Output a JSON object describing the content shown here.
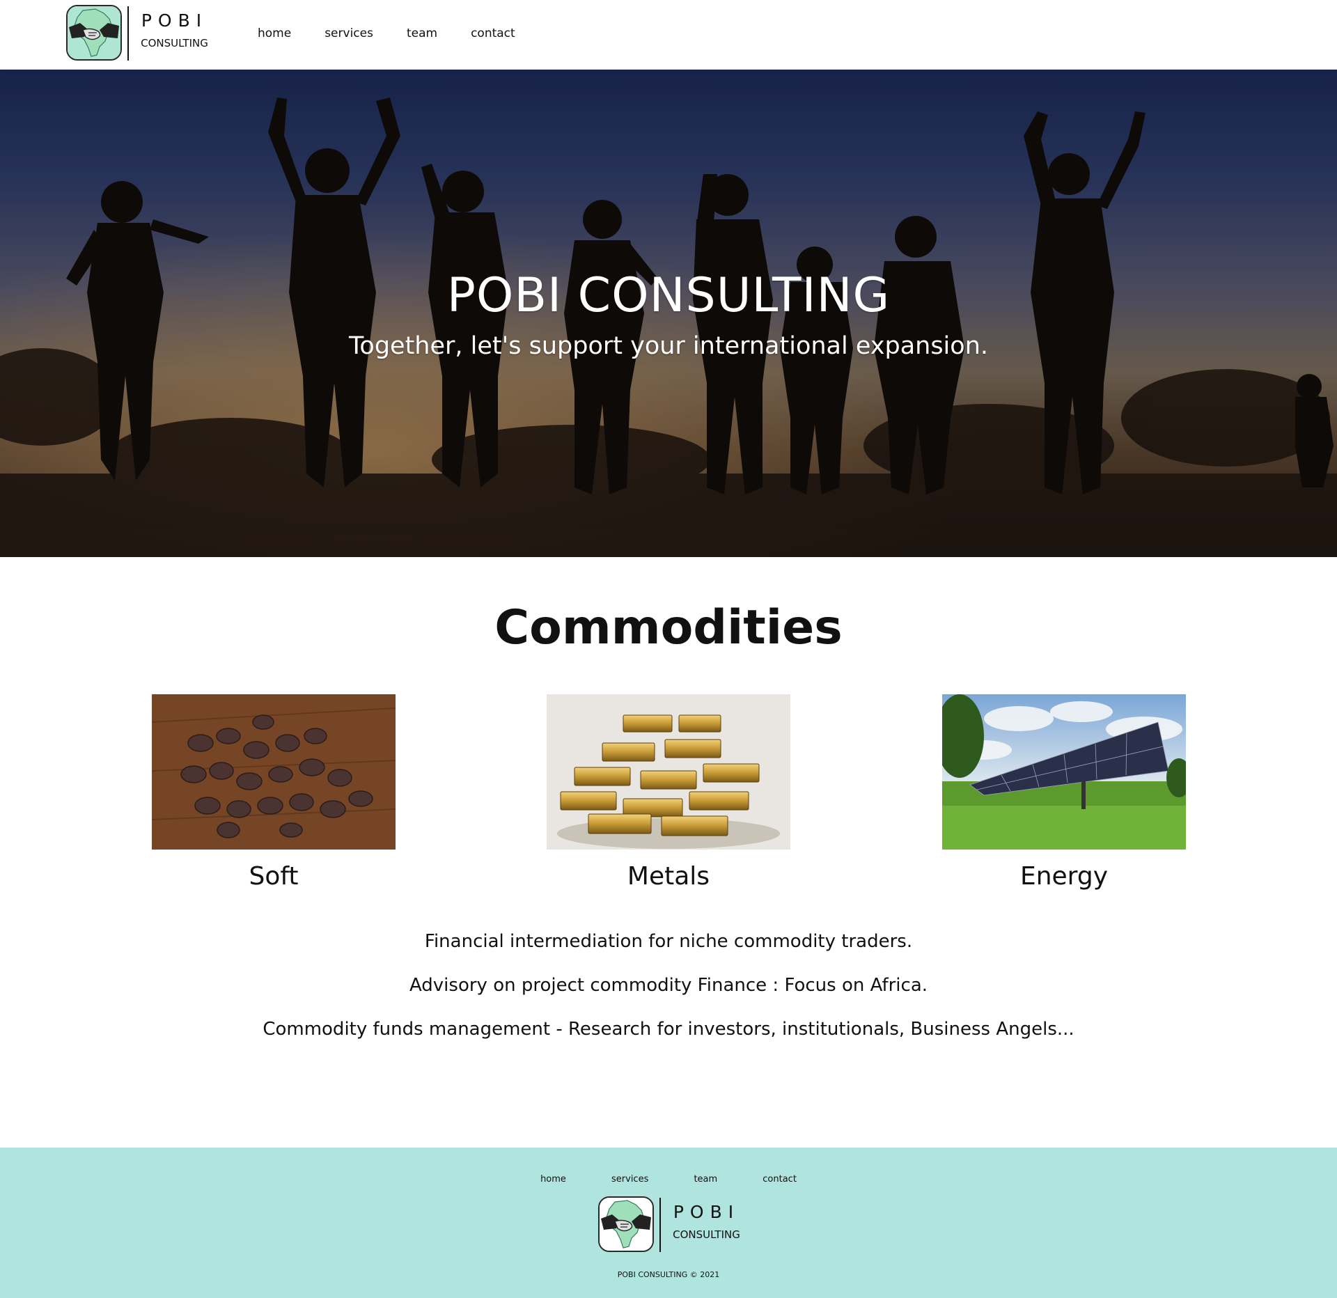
{
  "brand": {
    "name": "POBI",
    "subname": "CONSULTING"
  },
  "nav": {
    "items": [
      {
        "label": "home"
      },
      {
        "label": "services"
      },
      {
        "label": "team"
      },
      {
        "label": "contact"
      }
    ]
  },
  "hero": {
    "title": "POBI CONSULTING",
    "subtitle": "Together, let's support your international expansion."
  },
  "commodities": {
    "title": "Commodities",
    "cards": [
      {
        "label": "Soft",
        "image": "cocoa-beans"
      },
      {
        "label": "Metals",
        "image": "gold-bars"
      },
      {
        "label": "Energy",
        "image": "solar-panels"
      }
    ],
    "descriptions": [
      "Financial intermediation for niche commodity traders.",
      "Advisory on project commodity Finance : Focus on Africa.",
      "Commodity funds management - Research for investors, institutionals, Business Angels..."
    ]
  },
  "footer": {
    "nav": [
      {
        "label": "home"
      },
      {
        "label": "services"
      },
      {
        "label": "team"
      },
      {
        "label": "contact"
      }
    ],
    "copyright": "POBI CONSULTING © 2021"
  },
  "colors": {
    "footer_bg": "#b0e4de",
    "logo_africa": "#9fdfb9",
    "text": "#111111",
    "hero_text": "#ffffff"
  }
}
